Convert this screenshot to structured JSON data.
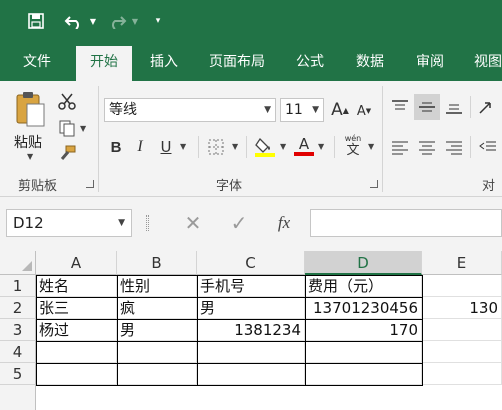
{
  "tabs": [
    "文件",
    "开始",
    "插入",
    "页面布局",
    "公式",
    "数据",
    "审阅",
    "视图"
  ],
  "active_tab": "开始",
  "ribbon": {
    "clipboard": {
      "paste_label": "粘贴",
      "group_label": "剪贴板"
    },
    "font": {
      "font_name": "等线",
      "font_size": "11",
      "bold": "B",
      "italic": "I",
      "underline": "U",
      "grow": "A",
      "shrink": "A",
      "font_color_glyph": "A",
      "wen_top": "wén",
      "wen_bottom": "文",
      "group_label": "字体",
      "fill_color": "#ffff00",
      "font_color": "#e00000"
    },
    "align": {
      "group_label": "对齐"
    }
  },
  "formula_bar": {
    "name_box": "D12",
    "fx": "fx",
    "formula": ""
  },
  "sheet": {
    "columns": [
      "A",
      "B",
      "C",
      "D",
      "E"
    ],
    "selected_column": "D",
    "rows": [
      "1",
      "2",
      "3",
      "4",
      "5"
    ],
    "cells": {
      "A1": "姓名",
      "B1": "性别",
      "C1": "手机号",
      "D1": "费用（元）",
      "A2": "张三",
      "B2": "疯",
      "C2": "男",
      "D2": "13701230456",
      "E2": "130",
      "A3": "杨过",
      "B3": "男",
      "C3": "1381234",
      "D3": "170"
    }
  }
}
